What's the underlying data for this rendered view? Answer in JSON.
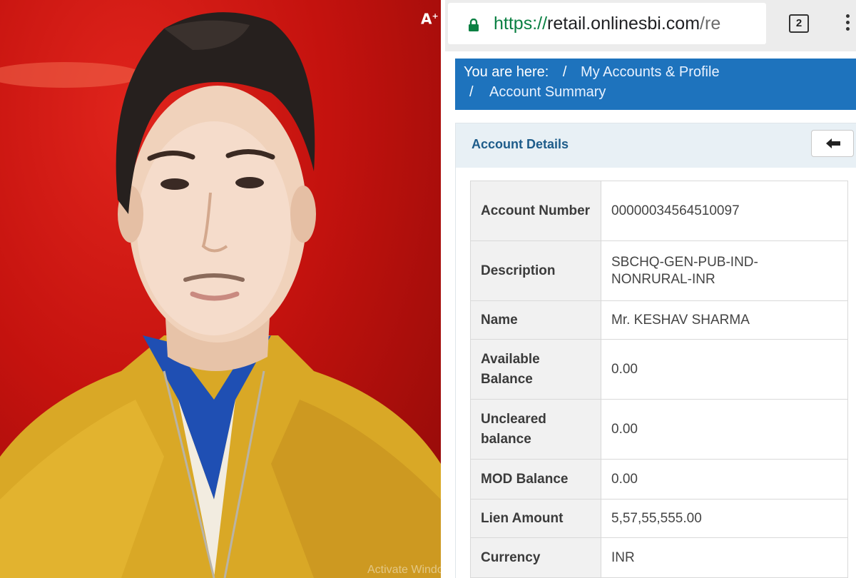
{
  "photo": {
    "watermark": "Activate Windo",
    "badge": "A"
  },
  "browser": {
    "url_scheme": "https://",
    "url_host": "retail.onlinesbi.com",
    "url_rest": "/re",
    "tab_count": "2"
  },
  "breadcrumb": {
    "prefix": "You are here:",
    "sep": "/",
    "item1": "My Accounts & Profile",
    "item2": "Account Summary"
  },
  "panel": {
    "title": "Account Details"
  },
  "details": [
    {
      "key": "Account Number",
      "value": "00000034564510097"
    },
    {
      "key": "Description",
      "value": "SBCHQ-GEN-PUB-IND-NONRURAL-INR"
    },
    {
      "key": "Name",
      "value": "Mr. KESHAV SHARMA"
    },
    {
      "key": "Available Balance",
      "value": "0.00"
    },
    {
      "key": "Uncleared balance",
      "value": "0.00"
    },
    {
      "key": "MOD Balance",
      "value": "0.00"
    },
    {
      "key": "Lien Amount",
      "value": "5,57,55,555.00"
    },
    {
      "key": "Currency",
      "value": "INR"
    }
  ],
  "colors": {
    "breadcrumb_bg": "#1e73bd",
    "panel_title": "#1e5c8a",
    "secure_green": "#0b8043",
    "photo_bg": "#c4120e",
    "jacket": "#d9a826"
  }
}
